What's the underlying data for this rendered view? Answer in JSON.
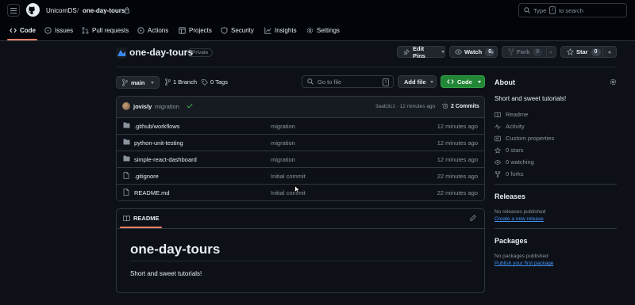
{
  "header": {
    "owner": "UnicornDS",
    "separator": "/",
    "repo": "one-day-tours",
    "search_placeholder": "Type / to search",
    "search_prefix": "Type",
    "search_key": "/",
    "search_suffix": "to search"
  },
  "tabs": [
    {
      "label": "Code",
      "icon": "code-icon",
      "active": true
    },
    {
      "label": "Issues",
      "icon": "issue-icon"
    },
    {
      "label": "Pull requests",
      "icon": "pull-request-icon"
    },
    {
      "label": "Actions",
      "icon": "play-icon"
    },
    {
      "label": "Projects",
      "icon": "table-icon"
    },
    {
      "label": "Security",
      "icon": "shield-icon"
    },
    {
      "label": "Insights",
      "icon": "graph-icon"
    },
    {
      "label": "Settings",
      "icon": "gear-icon"
    }
  ],
  "repo_head": {
    "name": "one-day-tours",
    "visibility": "Private",
    "edit_pins": "Edit Pins",
    "watch": "Watch",
    "watch_count": "0",
    "fork": "Fork",
    "fork_count": "0",
    "star": "Star",
    "star_count": "0"
  },
  "toolbar": {
    "branch": "main",
    "branch_count": "1 Branch",
    "tags": "0 Tags",
    "goto_placeholder": "Go to file",
    "goto_key": "t",
    "add_file": "Add file",
    "code": "Code"
  },
  "commit": {
    "author": "jovisly",
    "message": "migration",
    "sha_time": "3aab3c1 · 12 minutes ago",
    "commits": "2 Commits"
  },
  "files": [
    {
      "name": ".github/workflows",
      "type": "dir",
      "message": "migration",
      "time": "12 minutes ago"
    },
    {
      "name": "python-unit-testing",
      "type": "dir",
      "message": "migration",
      "time": "12 minutes ago"
    },
    {
      "name": "simple-react-dashboard",
      "type": "dir",
      "message": "migration",
      "time": "12 minutes ago"
    },
    {
      "name": ".gitignore",
      "type": "file",
      "message": "Initial commit",
      "time": "22 minutes ago"
    },
    {
      "name": "README.md",
      "type": "file",
      "message": "Initial commit",
      "time": "22 minutes ago"
    }
  ],
  "readme": {
    "tab": "README",
    "title": "one-day-tours",
    "body": "Short and sweet tutorials!"
  },
  "about": {
    "heading": "About",
    "description": "Short and sweet tutorials!",
    "links": [
      {
        "label": "Readme",
        "icon": "book-icon"
      },
      {
        "label": "Activity",
        "icon": "pulse-icon"
      },
      {
        "label": "Custom properties",
        "icon": "note-icon"
      },
      {
        "label": "0 stars",
        "icon": "star-icon"
      },
      {
        "label": "0 watching",
        "icon": "eye-icon"
      },
      {
        "label": "0 forks",
        "icon": "fork-icon"
      }
    ]
  },
  "releases": {
    "heading": "Releases",
    "empty": "No releases published",
    "cta": "Create a new release"
  },
  "packages": {
    "heading": "Packages",
    "empty": "No packages published",
    "cta": "Publish your first package"
  },
  "colors": {
    "accent": "#4493f8",
    "code_button": "#238636",
    "active_tab": "#f78166",
    "background": "#0d1117"
  }
}
